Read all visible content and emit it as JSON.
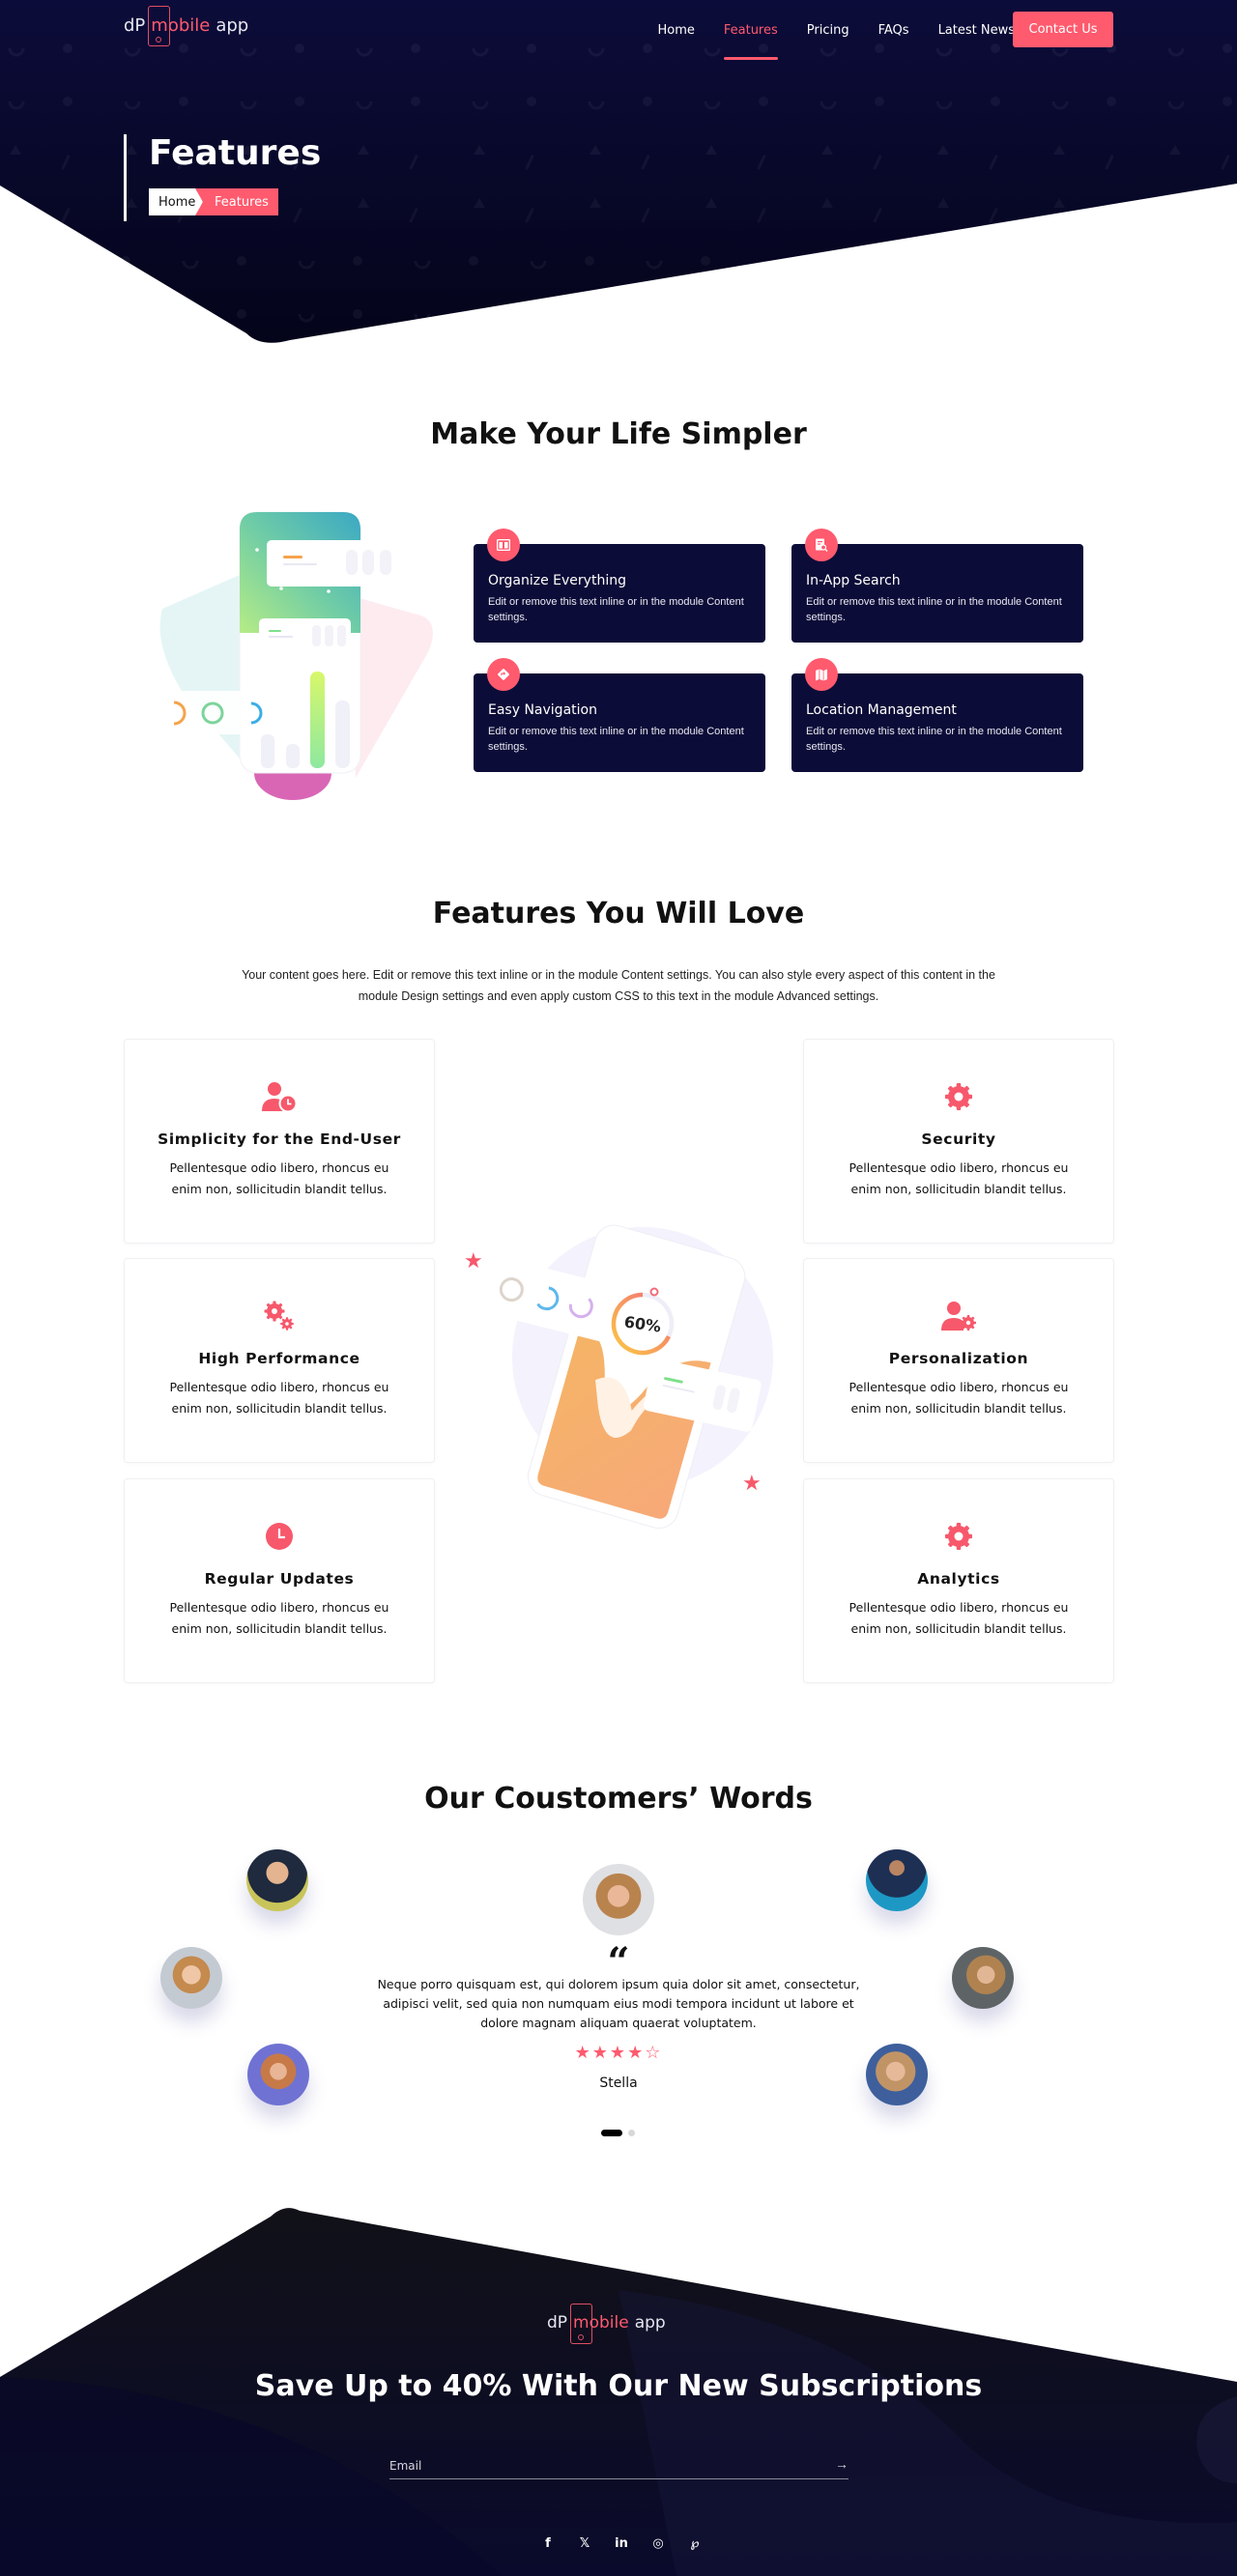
{
  "nav": {
    "logo": {
      "prefix": "dP",
      "highlight": "mobile",
      "suffix": "app"
    },
    "links": [
      {
        "label": "Home",
        "active": false
      },
      {
        "label": "Features",
        "active": true
      },
      {
        "label": "Pricing",
        "active": false
      },
      {
        "label": "FAQs",
        "active": false
      },
      {
        "label": "Latest News",
        "active": false
      }
    ],
    "cta_label": "Contact Us"
  },
  "hero": {
    "title": "Features",
    "breadcrumb": {
      "home": "Home",
      "current": "Features"
    }
  },
  "section1": {
    "title": "Make Your Life Simpler",
    "cards": [
      {
        "icon": "columns-icon",
        "title": "Organize Everything",
        "desc": "Edit or remove this text inline or in the module Content settings."
      },
      {
        "icon": "search-document-icon",
        "title": "In-App Search",
        "desc": "Edit or remove this text inline or in the module Content settings."
      },
      {
        "icon": "directions-icon",
        "title": "Easy Navigation",
        "desc": "Edit or remove this text inline or in the module Content settings."
      },
      {
        "icon": "map-icon",
        "title": "Location Management",
        "desc": "Edit or remove this text inline or in the module Content settings."
      }
    ]
  },
  "section2": {
    "title": "Features You Will Love",
    "desc": "Your content goes here. Edit or remove this text inline or in the module Content settings. You can also style every aspect of this content in the module Design settings and even apply custom CSS to this text in the module Advanced settings.",
    "illustration_percent": "60%",
    "cards": [
      {
        "icon": "user-clock-icon",
        "title": "Simplicity for the End-User",
        "desc": "Pellentesque odio libero, rhoncus eu enim non, sollicitudin blandit tellus."
      },
      {
        "icon": "gear-icon",
        "title": "Security",
        "desc": "Pellentesque odio libero, rhoncus eu enim non, sollicitudin blandit tellus."
      },
      {
        "icon": "gears-icon",
        "title": "High Performance",
        "desc": "Pellentesque odio libero, rhoncus eu enim non, sollicitudin blandit tellus."
      },
      {
        "icon": "user-gear-icon",
        "title": "Personalization",
        "desc": "Pellentesque odio libero, rhoncus eu enim non, sollicitudin blandit tellus."
      },
      {
        "icon": "clock-icon",
        "title": "Regular Updates",
        "desc": "Pellentesque odio libero, rhoncus eu enim non, sollicitudin blandit tellus."
      },
      {
        "icon": "gear-icon",
        "title": "Analytics",
        "desc": "Pellentesque odio libero, rhoncus eu enim non, sollicitudin blandit tellus."
      }
    ]
  },
  "testimonials": {
    "title": "Our Coustomers’ Words",
    "quote_mark": "“",
    "text": "Neque porro quisquam est, qui dolorem ipsum quia dolor sit amet, consectetur, adipisci velit, sed quia non numquam eius modi tempora incidunt ut labore et dolore magnam aliquam quaerat voluptatem.",
    "rating": 4,
    "rating_max": 5,
    "name": "Stella",
    "slide_count": 2,
    "active_slide": 1
  },
  "footer": {
    "logo": {
      "prefix": "dP",
      "highlight": "mobile",
      "suffix": "app"
    },
    "title": "Save Up to 40% With Our New Subscriptions",
    "email_placeholder": "Email",
    "submit_arrow": "→",
    "socials": [
      {
        "name": "facebook",
        "glyph": "f"
      },
      {
        "name": "x",
        "glyph": "𝕏"
      },
      {
        "name": "linkedin",
        "glyph": "in"
      },
      {
        "name": "instagram",
        "glyph": "◎"
      },
      {
        "name": "pinterest",
        "glyph": "℘"
      }
    ]
  },
  "colors": {
    "navy": "#0c0c38",
    "accent": "#ff5a6e"
  }
}
